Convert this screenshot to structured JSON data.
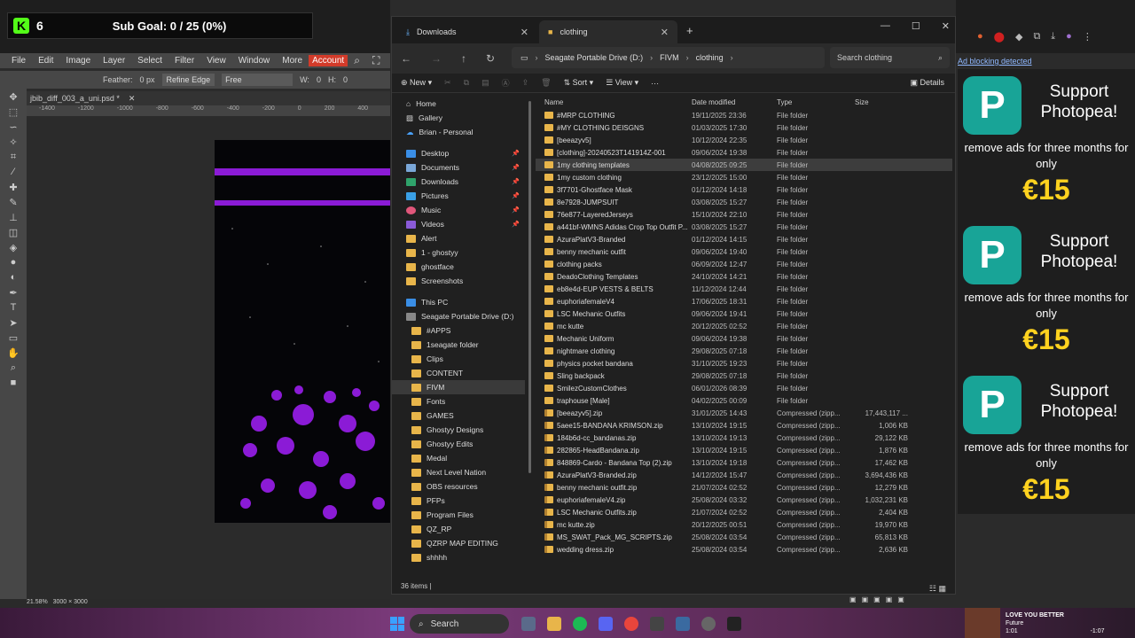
{
  "kick": {
    "count": "6",
    "goal": "Sub Goal: 0 / 25 (0%)"
  },
  "photopea": {
    "menu": [
      "File",
      "Edit",
      "Image",
      "Layer",
      "Select",
      "Filter",
      "View",
      "Window",
      "More"
    ],
    "account": "Account",
    "feather_label": "Feather:",
    "feather_value": "0 px",
    "refine_edge": "Refine Edge",
    "style_value": "Free",
    "w_label": "W:",
    "w_value": "0",
    "h_label": "H:",
    "h_value": "0",
    "doc_tab": "jbib_diff_003_a_uni.psd *",
    "ruler_ticks": [
      "-1400",
      "-1200",
      "-1000",
      "-800",
      "-600",
      "-400",
      "-200",
      "0",
      "200",
      "400",
      "600",
      "800",
      "1000",
      "1200",
      "1400"
    ],
    "zoom": "21.58%",
    "doc_size": "3000 × 3000"
  },
  "explorer": {
    "tabs": [
      {
        "label": "Downloads",
        "icon": "download-icon"
      },
      {
        "label": "clothing",
        "icon": "folder-icon"
      }
    ],
    "breadcrumb": [
      "Seagate Portable Drive (D:)",
      "FIVM",
      "clothing"
    ],
    "search_placeholder": "Search clothing",
    "commands": {
      "new": "New",
      "sort": "Sort",
      "view": "View",
      "more": "···",
      "details": "Details"
    },
    "columns": {
      "name": "Name",
      "date": "Date modified",
      "type": "Type",
      "size": "Size"
    },
    "nav_top": [
      {
        "label": "Home",
        "icon": "home-icon"
      },
      {
        "label": "Gallery",
        "icon": "gallery-icon"
      },
      {
        "label": "Brian - Personal",
        "icon": "cloud-icon"
      }
    ],
    "nav_quick": [
      {
        "label": "Desktop",
        "pinned": true
      },
      {
        "label": "Documents",
        "pinned": true
      },
      {
        "label": "Downloads",
        "pinned": true
      },
      {
        "label": "Pictures",
        "pinned": true
      },
      {
        "label": "Music",
        "pinned": true
      },
      {
        "label": "Videos",
        "pinned": true
      },
      {
        "label": "Alert",
        "pinned": false
      },
      {
        "label": "1 - ghostyy",
        "pinned": false
      },
      {
        "label": "ghostface",
        "pinned": false
      },
      {
        "label": "Screenshots",
        "pinned": false
      }
    ],
    "this_pc": "This PC",
    "drive": "Seagate Portable Drive (D:)",
    "drive_folders": [
      "#APPS",
      "1seagate folder",
      "Clips",
      "CONTENT",
      "FIVM",
      "Fonts",
      "GAMES",
      "Ghostyy Designs",
      "Ghostyy Edits",
      "Medal",
      "Next Level Nation",
      "OBS resources",
      "PFPs",
      "Program Files",
      "QZ_RP",
      "QZRP MAP EDITING",
      "shhhh"
    ],
    "selected_nav": "FIVM",
    "files": [
      {
        "name": "#MRP CLOTHING",
        "date": "19/11/2025 23:36",
        "type": "File folder",
        "size": "",
        "kind": "folder"
      },
      {
        "name": "#MY CLOTHING DEISGNS",
        "date": "01/03/2025 17:30",
        "type": "File folder",
        "size": "",
        "kind": "folder"
      },
      {
        "name": "[beeazyv5]",
        "date": "10/12/2024 22:35",
        "type": "File folder",
        "size": "",
        "kind": "folder"
      },
      {
        "name": "[clothing]-20240523T141914Z-001",
        "date": "09/06/2024 19:38",
        "type": "File folder",
        "size": "",
        "kind": "folder"
      },
      {
        "name": "1my clothing templates",
        "date": "04/08/2025 09:25",
        "type": "File folder",
        "size": "",
        "kind": "folder",
        "highlight": true
      },
      {
        "name": "1my custom clothing",
        "date": "23/12/2025 15:00",
        "type": "File folder",
        "size": "",
        "kind": "folder"
      },
      {
        "name": "3f7701-Ghostface Mask",
        "date": "01/12/2024 14:18",
        "type": "File folder",
        "size": "",
        "kind": "folder"
      },
      {
        "name": "8e7928-JUMPSUIT",
        "date": "03/08/2025 15:27",
        "type": "File folder",
        "size": "",
        "kind": "folder"
      },
      {
        "name": "76e877-LayeredJerseys",
        "date": "15/10/2024 22:10",
        "type": "File folder",
        "size": "",
        "kind": "folder"
      },
      {
        "name": "a441bf-WMNS Adidas Crop Top Outfit P...",
        "date": "03/08/2025 15:27",
        "type": "File folder",
        "size": "",
        "kind": "folder"
      },
      {
        "name": "AzuraPlatV3-Branded",
        "date": "01/12/2024 14:15",
        "type": "File folder",
        "size": "",
        "kind": "folder"
      },
      {
        "name": "benny mechanic outfit",
        "date": "09/06/2024 19:40",
        "type": "File folder",
        "size": "",
        "kind": "folder"
      },
      {
        "name": "clothing packs",
        "date": "06/09/2024 12:47",
        "type": "File folder",
        "size": "",
        "kind": "folder"
      },
      {
        "name": "DeadoClothing Templates",
        "date": "24/10/2024 14:21",
        "type": "File folder",
        "size": "",
        "kind": "folder"
      },
      {
        "name": "eb8e4d-EUP VESTS & BELTS",
        "date": "11/12/2024 12:44",
        "type": "File folder",
        "size": "",
        "kind": "folder"
      },
      {
        "name": "euphoriafemaleV4",
        "date": "17/06/2025 18:31",
        "type": "File folder",
        "size": "",
        "kind": "folder"
      },
      {
        "name": "LSC Mechanic Outfits",
        "date": "09/06/2024 19:41",
        "type": "File folder",
        "size": "",
        "kind": "folder"
      },
      {
        "name": "mc kutte",
        "date": "20/12/2025 02:52",
        "type": "File folder",
        "size": "",
        "kind": "folder"
      },
      {
        "name": "Mechanic Uniform",
        "date": "09/06/2024 19:38",
        "type": "File folder",
        "size": "",
        "kind": "folder"
      },
      {
        "name": "nightmare clothing",
        "date": "29/08/2025 07:18",
        "type": "File folder",
        "size": "",
        "kind": "folder"
      },
      {
        "name": "physics pocket bandana",
        "date": "31/10/2025 19:23",
        "type": "File folder",
        "size": "",
        "kind": "folder"
      },
      {
        "name": "Sling backpack",
        "date": "29/08/2025 07:18",
        "type": "File folder",
        "size": "",
        "kind": "folder"
      },
      {
        "name": "SmilezCustomClothes",
        "date": "06/01/2026 08:39",
        "type": "File folder",
        "size": "",
        "kind": "folder"
      },
      {
        "name": "traphouse [Male]",
        "date": "04/02/2025 00:09",
        "type": "File folder",
        "size": "",
        "kind": "folder"
      },
      {
        "name": "[beeazyv5].zip",
        "date": "31/01/2025 14:43",
        "type": "Compressed (zipp...",
        "size": "17,443,117 ...",
        "kind": "zip"
      },
      {
        "name": "5aee15-BANDANA KRIMSON.zip",
        "date": "13/10/2024 19:15",
        "type": "Compressed (zipp...",
        "size": "1,006 KB",
        "kind": "zip"
      },
      {
        "name": "184b6d-cc_bandanas.zip",
        "date": "13/10/2024 19:13",
        "type": "Compressed (zipp...",
        "size": "29,122 KB",
        "kind": "zip"
      },
      {
        "name": "282865-HeadBandana.zip",
        "date": "13/10/2024 19:15",
        "type": "Compressed (zipp...",
        "size": "1,876 KB",
        "kind": "zip"
      },
      {
        "name": "848869-Cardo - Bandana Top (2).zip",
        "date": "13/10/2024 19:18",
        "type": "Compressed (zipp...",
        "size": "17,462 KB",
        "kind": "zip"
      },
      {
        "name": "AzuraPlatV3-Branded.zip",
        "date": "14/12/2024 15:47",
        "type": "Compressed (zipp...",
        "size": "3,694,436 KB",
        "kind": "zip"
      },
      {
        "name": "benny mechanic outfit.zip",
        "date": "21/07/2024 02:52",
        "type": "Compressed (zipp...",
        "size": "12,279 KB",
        "kind": "zip"
      },
      {
        "name": "euphoriafemaleV4.zip",
        "date": "25/08/2024 03:32",
        "type": "Compressed (zipp...",
        "size": "1,032,231 KB",
        "kind": "zip"
      },
      {
        "name": "LSC Mechanic Outfits.zip",
        "date": "21/07/2024 02:52",
        "type": "Compressed (zipp...",
        "size": "2,404 KB",
        "kind": "zip"
      },
      {
        "name": "mc kutte.zip",
        "date": "20/12/2025 00:51",
        "type": "Compressed (zipp...",
        "size": "19,970 KB",
        "kind": "zip"
      },
      {
        "name": "MS_SWAT_Pack_MG_SCRIPTS.zip",
        "date": "25/08/2024 03:54",
        "type": "Compressed (zipp...",
        "size": "65,813 KB",
        "kind": "zip"
      },
      {
        "name": "wedding dress.zip",
        "date": "25/08/2024 03:54",
        "type": "Compressed (zipp...",
        "size": "2,636 KB",
        "kind": "zip"
      }
    ],
    "status": "36 items"
  },
  "ads": {
    "blocked": "Ad blocking detected",
    "support": "Support Photopea!",
    "remove": "remove ads for three months for only",
    "price": "€15"
  },
  "taskbar": {
    "search": "Search",
    "song_title": "LOVE YOU BETTER",
    "song_artist": "Future",
    "elapsed": "1:01",
    "remaining": "-1:07"
  },
  "colors": {
    "accent": "#8b1bd6",
    "photopea_teal": "#18a497",
    "price_yellow": "#ffd21f",
    "folder": "#e8b54a",
    "kick_green": "#53fc18",
    "account_red": "#d23b2a"
  }
}
